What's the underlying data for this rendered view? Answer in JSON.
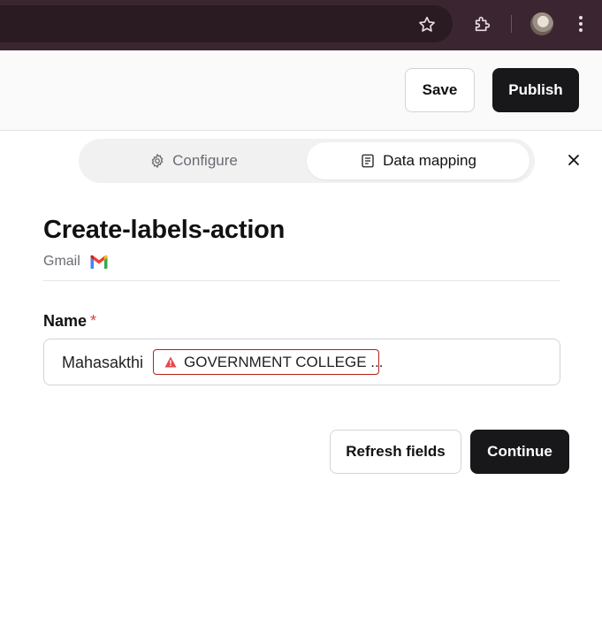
{
  "toolbar": {
    "save_label": "Save",
    "publish_label": "Publish"
  },
  "tabs": [
    {
      "label": "Configure",
      "icon": "gear-icon",
      "active": false
    },
    {
      "label": "Data mapping",
      "icon": "document-icon",
      "active": true
    }
  ],
  "action": {
    "title": "Create-labels-action",
    "app_name": "Gmail",
    "app_icon": "gmail-icon"
  },
  "form": {
    "name_label": "Name",
    "required_mark": "*",
    "name_value_text": "Mahasakthi",
    "name_value_pill": "GOVERNMENT COLLEGE ...",
    "pill_status": "warning"
  },
  "buttons": {
    "refresh_label": "Refresh fields",
    "continue_label": "Continue"
  },
  "colors": {
    "chrome_bg": "#3b2530",
    "primary_button": "#18181b",
    "required": "#d6453d",
    "warning": "#e5484d"
  }
}
